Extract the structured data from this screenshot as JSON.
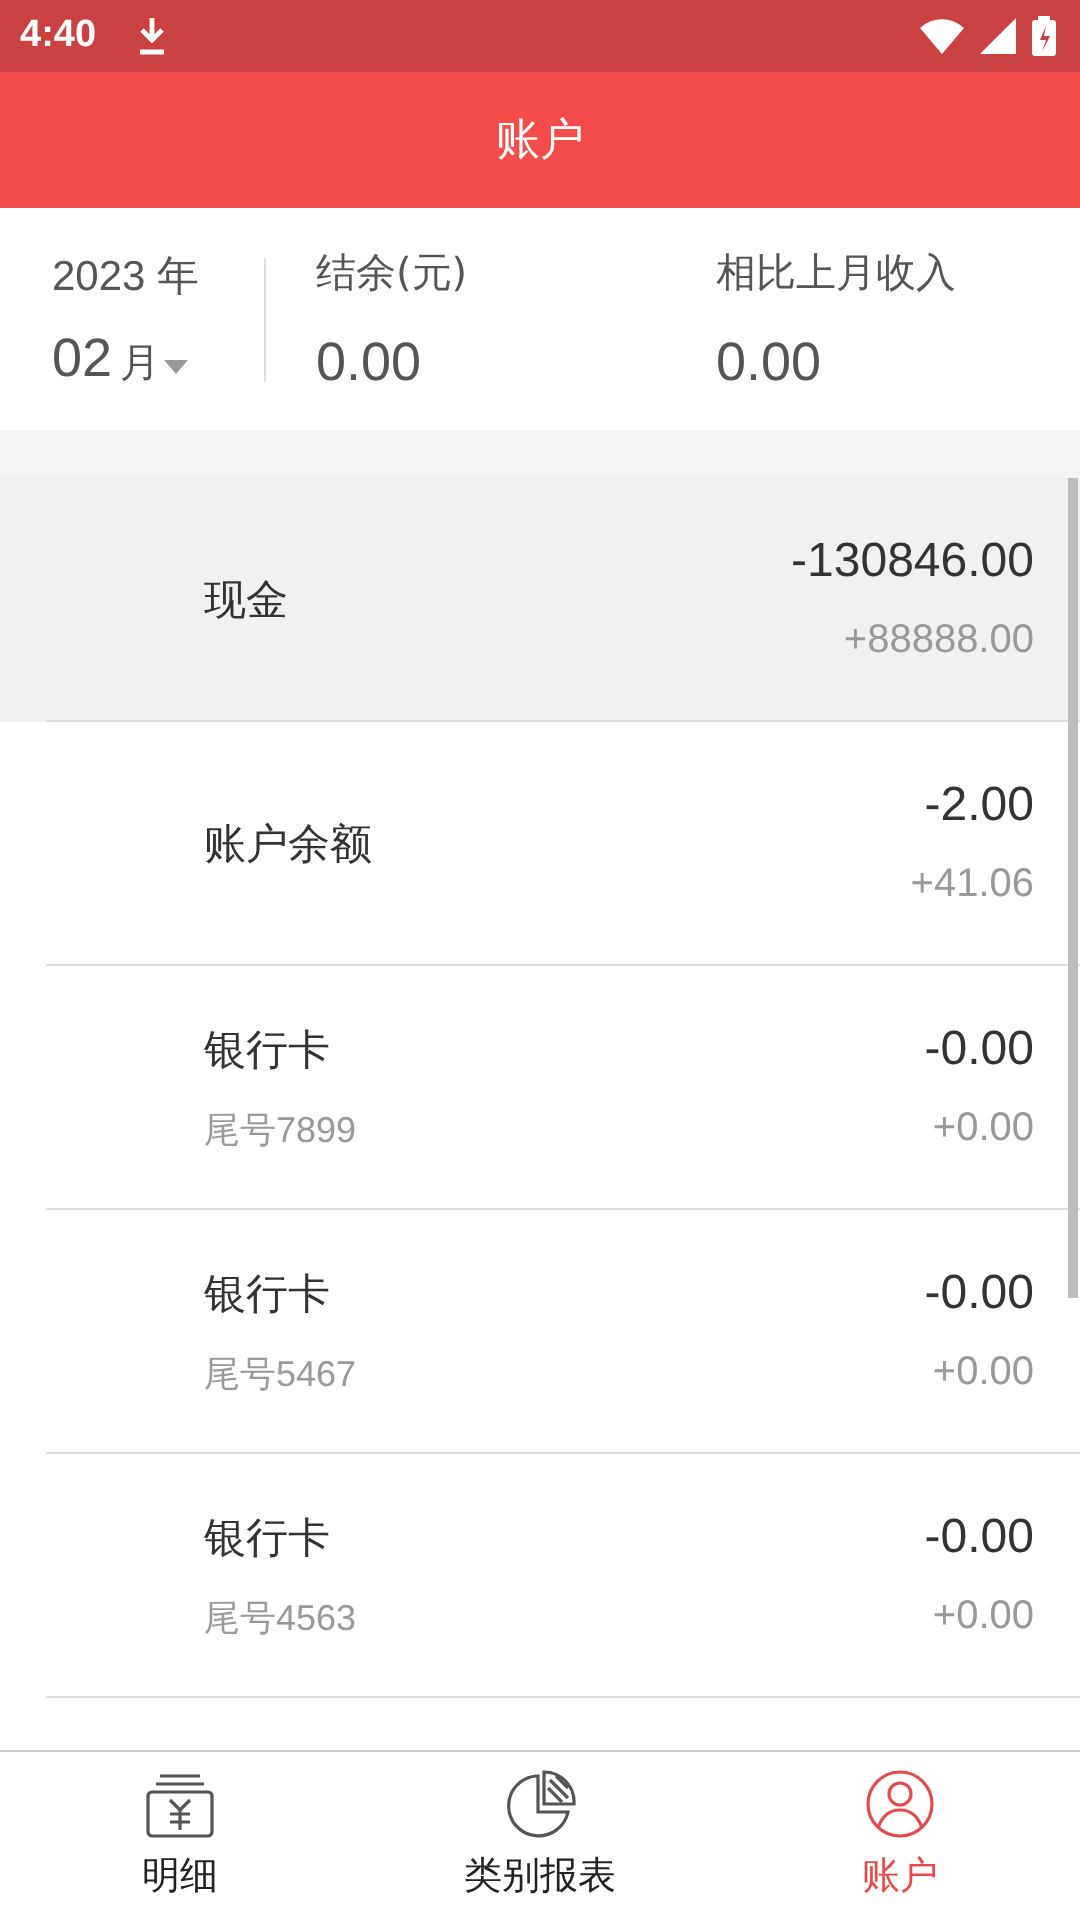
{
  "status_bar": {
    "time": "4:40"
  },
  "header": {
    "title": "账户"
  },
  "summary": {
    "year": "2023 年",
    "month": "02",
    "month_unit": "月",
    "balance_label": "结余(元)",
    "balance_value": "0.00",
    "compare_label": "相比上月收入",
    "compare_value": "0.00"
  },
  "accounts": [
    {
      "name": "现金",
      "amount": "-130846.00",
      "change": "+88888.00",
      "selected": true
    },
    {
      "name": "账户余额",
      "amount": "-2.00",
      "change": "+41.06",
      "selected": false
    },
    {
      "name": "银行卡",
      "subtitle": "尾号7899",
      "amount": "-0.00",
      "change": "+0.00",
      "selected": false
    },
    {
      "name": "银行卡",
      "subtitle": "尾号5467",
      "amount": "-0.00",
      "change": "+0.00",
      "selected": false
    },
    {
      "name": "银行卡",
      "subtitle": "尾号4563",
      "amount": "-0.00",
      "change": "+0.00",
      "selected": false
    }
  ],
  "nav": [
    {
      "kind": "ledger",
      "label": "明细",
      "selected": false
    },
    {
      "kind": "pie",
      "label": "类别报表",
      "selected": false
    },
    {
      "kind": "person",
      "label": "账户",
      "selected": true
    }
  ]
}
